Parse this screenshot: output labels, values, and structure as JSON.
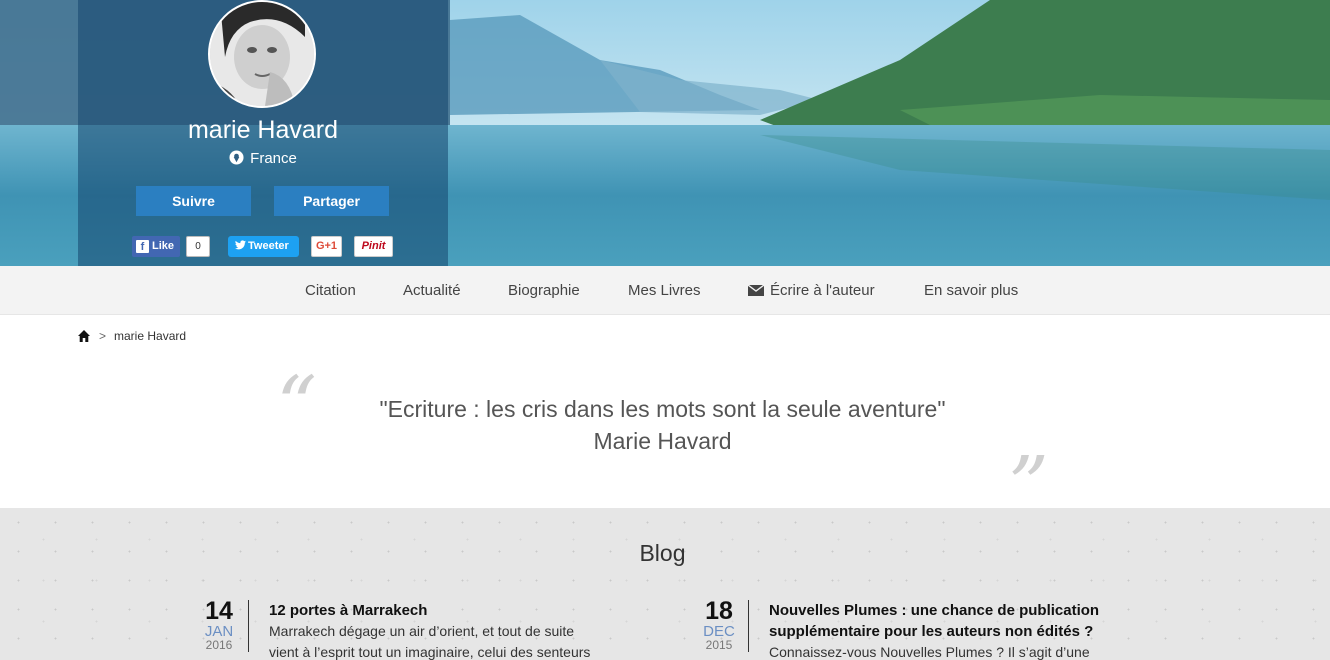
{
  "profile": {
    "name": "marie Havard",
    "location": "France",
    "follow_label": "Suivre",
    "share_label": "Partager"
  },
  "social": {
    "fb_label": "Like",
    "fb_count": "0",
    "twitter_label": "Tweeter",
    "gplus_label": "G+1",
    "pinterest_label": "Pinit"
  },
  "nav": {
    "items": [
      "Citation",
      "Actualité",
      "Biographie",
      "Mes Livres",
      "Écrire à l'auteur",
      "En savoir plus"
    ]
  },
  "breadcrumb": {
    "separator": ">",
    "current": "marie Havard"
  },
  "quote": {
    "text": "\"Ecriture : les cris dans les mots sont la seule aventure\"",
    "author": "Marie Havard"
  },
  "blog": {
    "title": "Blog",
    "posts": [
      {
        "day": "14",
        "month": "JAN",
        "year": "2016",
        "title_lines": [
          "12 portes à Marrakech"
        ],
        "excerpt_lines": [
          "Marrakech dégage un air d’orient, et tout de suite",
          "vient à l’esprit tout un imaginaire, celui des senteurs"
        ]
      },
      {
        "day": "18",
        "month": "DEC",
        "year": "2015",
        "title_lines": [
          "Nouvelles Plumes : une chance de publication",
          "supplémentaire pour les auteurs non édités ?"
        ],
        "excerpt_lines": [
          "Connaissez-vous Nouvelles Plumes ?  Il s’agit d’une"
        ]
      }
    ]
  },
  "colors": {
    "button_blue": "#2b7fc1",
    "profile_overlay": "rgba(20,70,110,0.55)",
    "nav_bg": "#f3f3f3",
    "month_blue": "#6b8fc3"
  }
}
